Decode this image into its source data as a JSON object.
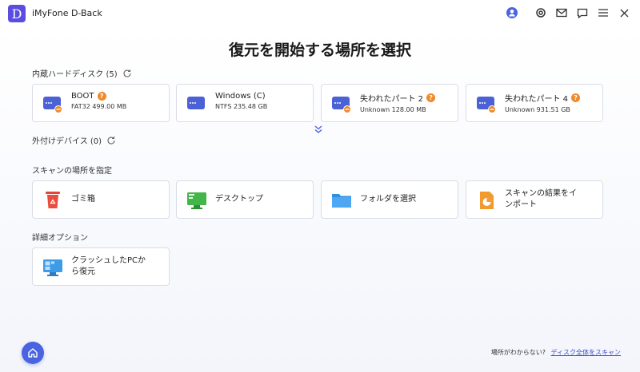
{
  "app": {
    "logo_letter": "D",
    "title": "iMyFone D-Back"
  },
  "window_icons": [
    "user-icon",
    "settings-icon",
    "mail-icon",
    "chat-icon",
    "menu-icon",
    "close-icon"
  ],
  "page_title": "復元を開始する場所を選択",
  "internal": {
    "label": "内蔵ハードディスク (5)",
    "drives": [
      {
        "name": "BOOT",
        "info": "FAT32 499.00 MB",
        "badge": "?"
      },
      {
        "name": "Windows (C)",
        "info": "NTFS 235.48 GB"
      },
      {
        "name": "失われたパート 2",
        "info": "Unknown 128.00 MB",
        "badge": "?"
      },
      {
        "name": "失われたパート 4",
        "info": "Unknown 931.51 GB",
        "badge": "?"
      }
    ]
  },
  "external": {
    "label": "外付けデバイス (0)"
  },
  "locations": {
    "label": "スキャンの場所を指定",
    "items": [
      {
        "name": "ゴミ箱"
      },
      {
        "name": "デスクトップ"
      },
      {
        "name": "フォルダを選択"
      },
      {
        "name_line1": "スキャンの結果をイ",
        "name_line2": "ンポート"
      }
    ]
  },
  "advanced": {
    "label": "詳細オプション",
    "items": [
      {
        "name_line1": "クラッシュしたPCか",
        "name_line2": "ら復元"
      }
    ]
  },
  "footer": {
    "question": "場所がわからない?",
    "link": "ディスク全体をスキャン"
  },
  "colors": {
    "accent": "#4a63e0",
    "badge": "#f0892a",
    "drive_icon": "#4b61d6"
  }
}
